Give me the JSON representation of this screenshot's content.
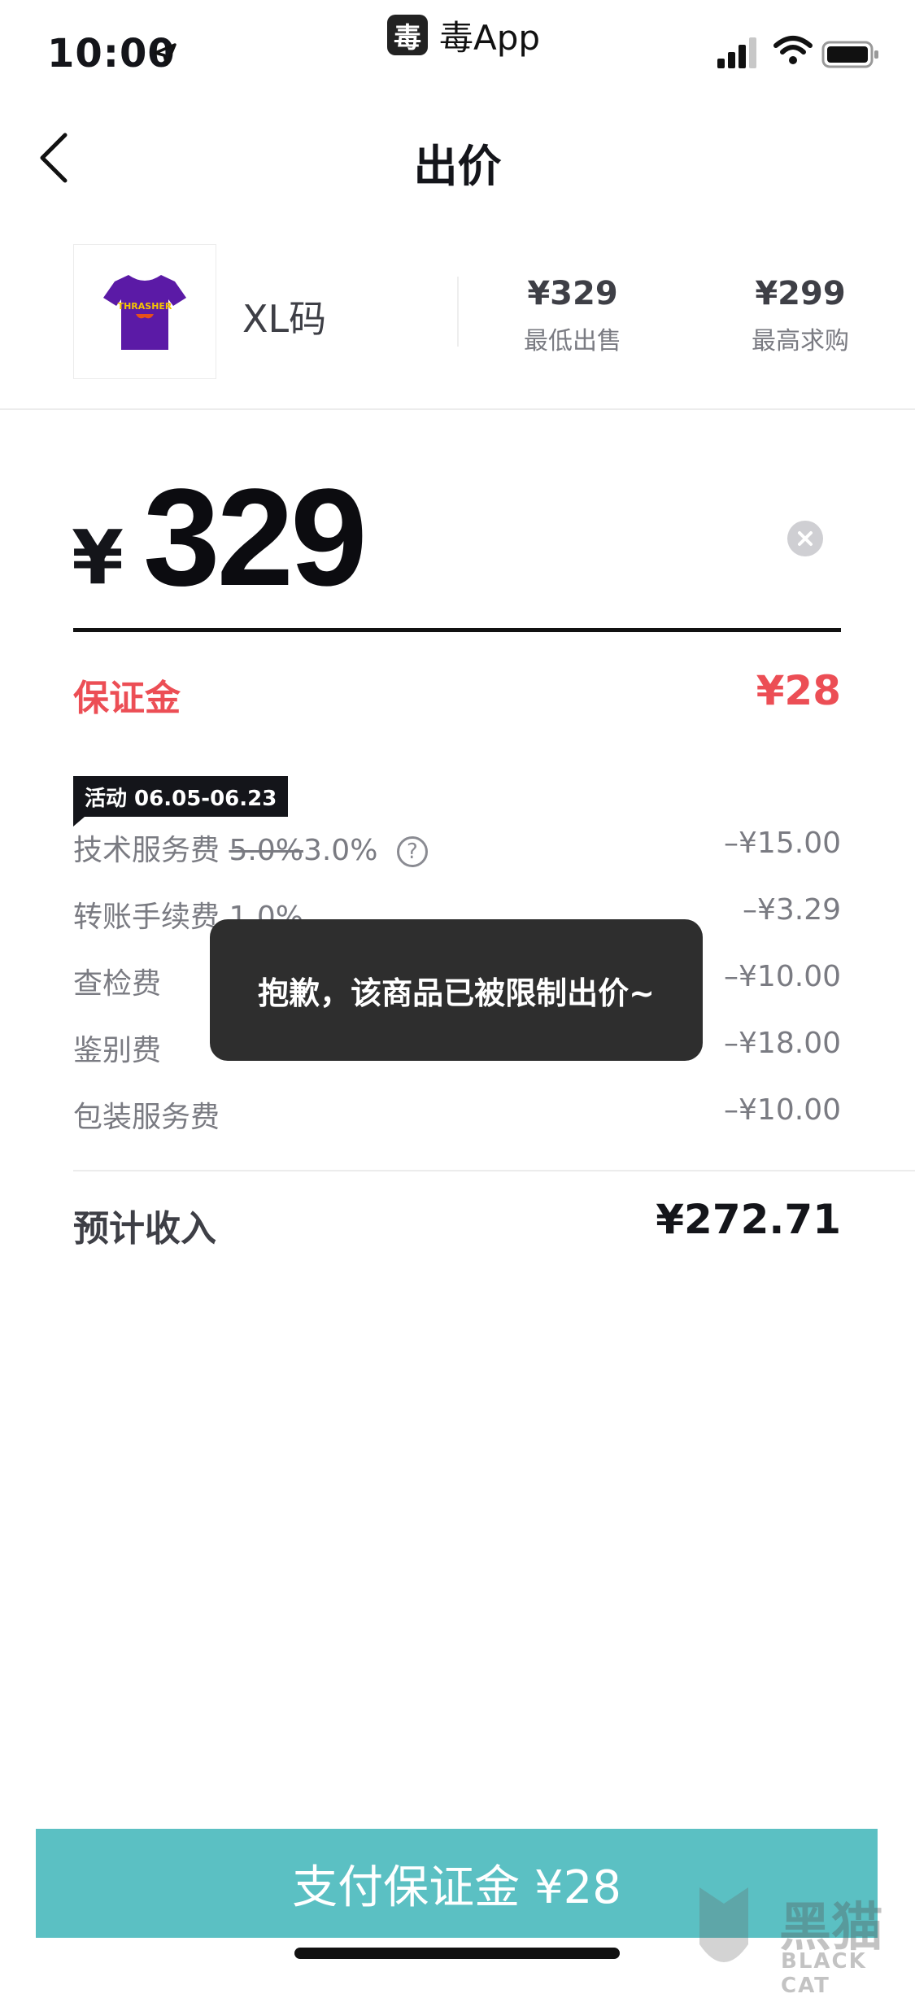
{
  "status_bar": {
    "time": "10:00",
    "app_badge": "毒",
    "app_name": "毒App"
  },
  "nav": {
    "title": "出价"
  },
  "product": {
    "size": "XL码",
    "lowest_sell_price": "¥329",
    "lowest_sell_label": "最低出售",
    "highest_bid_price": "¥299",
    "highest_bid_label": "最高求购",
    "shirt_text": "THRASHER",
    "shirt_color": "#5b1aa6"
  },
  "bid": {
    "currency": "¥",
    "amount": "329"
  },
  "deposit": {
    "label": "保证金",
    "value": "¥28",
    "color": "#ec4e55"
  },
  "promo": {
    "tag": "活动 06.05-06.23"
  },
  "fees": [
    {
      "label": "技术服务费",
      "old_rate": "5.0%",
      "new_rate": "3.0%",
      "value": "–¥15.00"
    },
    {
      "label": "转账手续费",
      "rate": "1.0%",
      "value": "–¥3.29"
    },
    {
      "label": "查检费",
      "value": "–¥10.00"
    },
    {
      "label": "鉴别费",
      "value": "–¥18.00"
    },
    {
      "label": "包装服务费",
      "value": "–¥10.00"
    }
  ],
  "help_glyph": "?",
  "income": {
    "label": "预计收入",
    "value": "¥272.71"
  },
  "toast": {
    "message": "抱歉，该商品已被限制出价~"
  },
  "pay_button": {
    "label": "支付保证金 ¥28",
    "color": "#5bc0c3"
  },
  "watermark": {
    "cn": "黑猫",
    "en": "BLACK CAT"
  }
}
